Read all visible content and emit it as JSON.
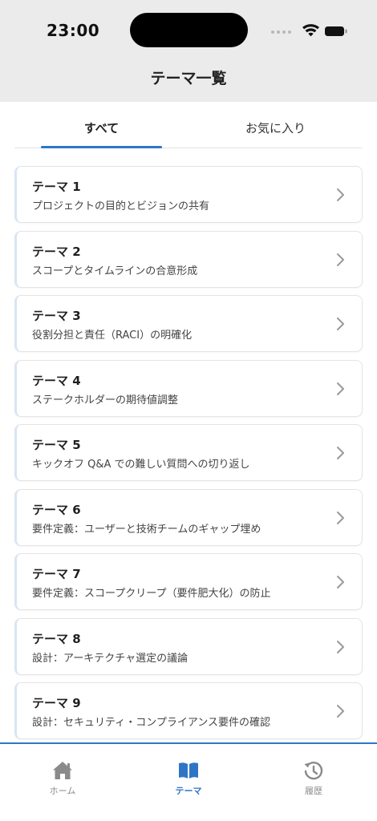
{
  "status": {
    "time": "23:00"
  },
  "header": {
    "title": "テーマ一覧"
  },
  "tabs": [
    {
      "label": "すべて",
      "active": true
    },
    {
      "label": "お気に入り",
      "active": false
    }
  ],
  "themes": [
    {
      "title": "テーマ 1",
      "subtitle": "プロジェクトの目的とビジョンの共有"
    },
    {
      "title": "テーマ 2",
      "subtitle": "スコープとタイムラインの合意形成"
    },
    {
      "title": "テーマ 3",
      "subtitle": "役割分担と責任（RACI）の明確化"
    },
    {
      "title": "テーマ 4",
      "subtitle": "ステークホルダーの期待値調整"
    },
    {
      "title": "テーマ 5",
      "subtitle": "キックオフ Q&A での難しい質問への切り返し"
    },
    {
      "title": "テーマ 6",
      "subtitle": "要件定義：ユーザーと技術チームのギャップ埋め"
    },
    {
      "title": "テーマ 7",
      "subtitle": "要件定義：スコープクリープ（要件肥大化）の防止"
    },
    {
      "title": "テーマ 8",
      "subtitle": "設計：アーキテクチャ選定の議論"
    },
    {
      "title": "テーマ 9",
      "subtitle": "設計：セキュリティ・コンプライアンス要件の確認"
    }
  ],
  "tabbar": [
    {
      "label": "ホーム",
      "icon": "home-icon",
      "active": false
    },
    {
      "label": "テーマ",
      "icon": "book-icon",
      "active": true
    },
    {
      "label": "履歴",
      "icon": "history-icon",
      "active": false
    }
  ],
  "colors": {
    "accent": "#2f75c6",
    "card_border_accent": "#d7e6f5",
    "header_bg": "#ebebeb"
  }
}
